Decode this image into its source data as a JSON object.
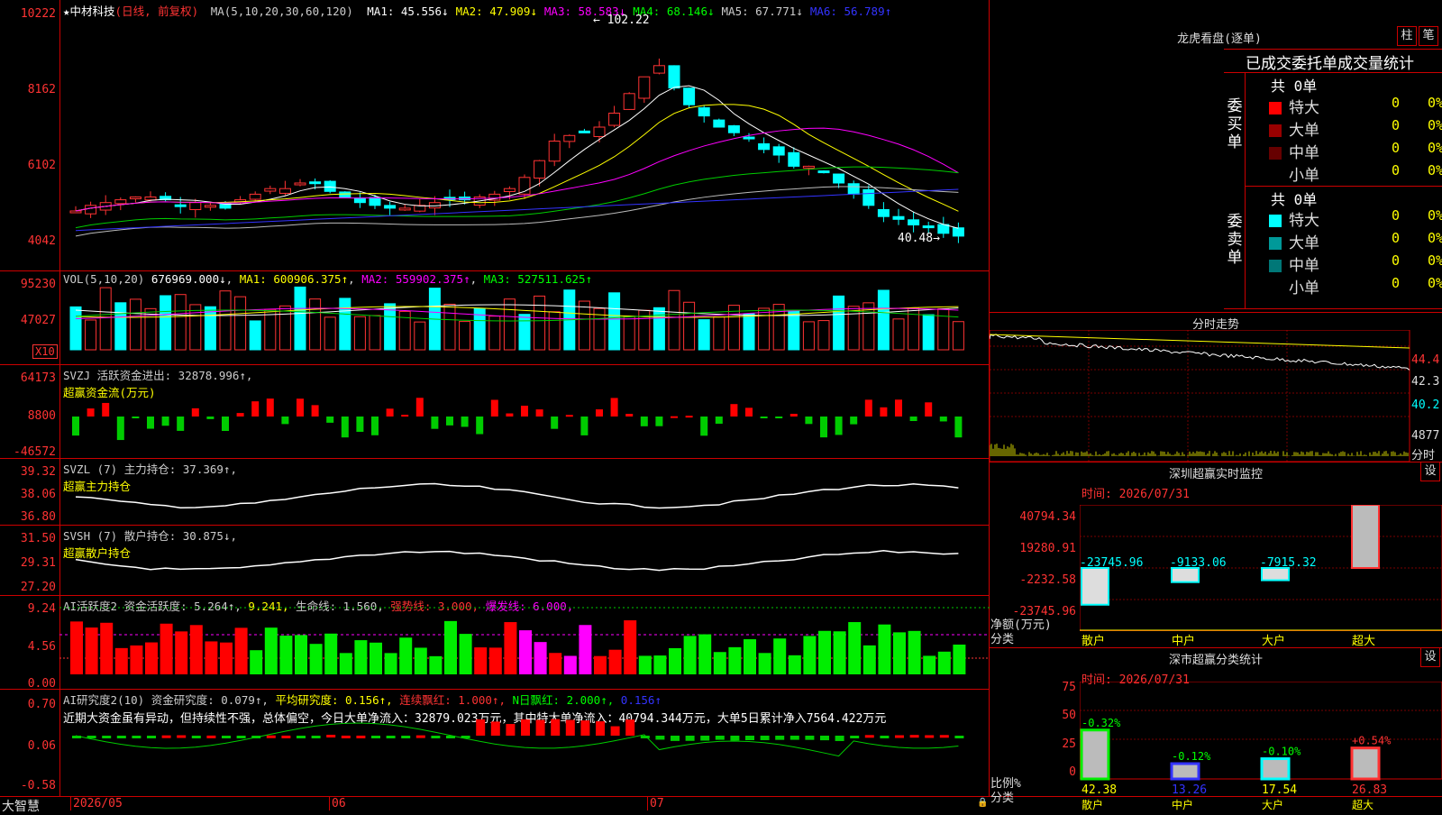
{
  "kline": {
    "star": "★",
    "name": "中材科技",
    "mode": "(日线, 前复权)",
    "ma_params": "MA(5,10,20,30,60,120)",
    "ma": [
      {
        "l": "MA1:",
        "v": "45.556↓",
        "c": "#fff"
      },
      {
        "l": "MA2:",
        "v": "47.909↓",
        "c": "#ff0"
      },
      {
        "l": "MA3:",
        "v": "58.583↓",
        "c": "#f0f"
      },
      {
        "l": "MA4:",
        "v": "68.146↓",
        "c": "#0f0"
      },
      {
        "l": "MA5:",
        "v": "67.771↓",
        "c": "#ccc"
      },
      {
        "l": "MA6:",
        "v": "56.789↑",
        "c": "#33f"
      }
    ],
    "axis": [
      "10222",
      "8162",
      "6102",
      "4042"
    ],
    "high_label": "102.22",
    "low_label": "40.48"
  },
  "vol": {
    "label": "VOL(5,10,20)",
    "v": "676969.000↓",
    "ma1": "MA1: 600906.375↑",
    "ma2": "MA2: 559902.375↑",
    "ma3": "MA3: 527511.625↑",
    "axis": [
      "95230",
      "47027"
    ],
    "unit": "X10"
  },
  "svzj": {
    "label": "SVZJ  活跃资金进出: 32878.996↑,",
    "sub": "超赢资金流(万元)",
    "axis": [
      "64173",
      "8800",
      "-46572"
    ]
  },
  "svzl": {
    "label": "SVZL (7) 主力持仓: 37.369↑,",
    "sub": "超赢主力持仓",
    "axis": [
      "39.32",
      "38.06",
      "36.80"
    ]
  },
  "svsh": {
    "label": "SVSH (7) 散户持仓: 30.875↓,",
    "sub": "超赢散户持仓",
    "axis": [
      "31.50",
      "29.31",
      "27.20"
    ]
  },
  "ai1": {
    "label": "AI活跃度2 资金活跃度: 5.264↑,",
    "v2": "9.241,",
    "life": "生命线: 1.560,",
    "strong": "强势线: 3.000,",
    "burst": "爆发线: 6.000,",
    "axis": [
      "9.24",
      "4.56",
      "0.00"
    ]
  },
  "ai2": {
    "label": "AI研究度2(10) 资金研究度: 0.079↑,",
    "avg": "平均研究度: 0.156↑,",
    "cont": "连续飘红: 1.000↑,",
    "nday": "N日飘红: 2.000↑,",
    "last": "0.156↑",
    "note": "近期大资金虽有异动，但持续性不强，总体偏空，今日大单净流入：32879.023万元，其中特大单净流入：40794.344万元，大单5日累计净入7564.422万元",
    "axis": [
      "0.70",
      "0.06",
      "-0.58"
    ]
  },
  "date_axis": {
    "brand": "大智慧",
    "d1": "2026/05",
    "d2": "06",
    "d3": "07"
  },
  "dragon": {
    "title": "龙虎看盘(逐单)",
    "btn1": "柱",
    "btn2": "笔",
    "subtitle": "已成交委托单成交量统计",
    "buy_side": "委买单",
    "sell_side": "委卖单",
    "buy_total": "共 0单",
    "sell_total": "共 0单",
    "buy_rows": [
      {
        "n": "特大",
        "v": "0",
        "p": "0%",
        "c": "#f00"
      },
      {
        "n": "大单",
        "v": "0",
        "p": "0%",
        "c": "#900"
      },
      {
        "n": "中单",
        "v": "0",
        "p": "0%",
        "c": "#600"
      },
      {
        "n": "小单",
        "v": "0",
        "p": "0%",
        "c": "#000"
      }
    ],
    "sell_rows": [
      {
        "n": "特大",
        "v": "0",
        "p": "0%",
        "c": "#0ff"
      },
      {
        "n": "大单",
        "v": "0",
        "p": "0%",
        "c": "#099"
      },
      {
        "n": "中单",
        "v": "0",
        "p": "0%",
        "c": "#077"
      },
      {
        "n": "小单",
        "v": "0",
        "p": "0%",
        "c": "#000"
      }
    ]
  },
  "intraday": {
    "title": "分时走势",
    "axis": [
      "44.4",
      "42.3",
      "40.2",
      "4877",
      "分时"
    ]
  },
  "monitor": {
    "title": "深圳超赢实时监控",
    "btn": "设",
    "time": "时间: 2026/07/31",
    "axis": [
      "40794.34",
      "19280.91",
      "-2232.58",
      "-23745.96"
    ],
    "ylabel": "净额(万元)",
    "xlabel": "分类",
    "cats": [
      "散户",
      "中户",
      "大户",
      "超大"
    ],
    "values": [
      "-23745.96",
      "-9133.06",
      "-7915.32",
      "40794.34"
    ]
  },
  "classify": {
    "title": "深市超赢分类统计",
    "btn": "设",
    "time": "时间: 2026/07/31",
    "axis": [
      "75",
      "50",
      "25",
      "0"
    ],
    "ylabel": "比例%",
    "xlabel": "分类",
    "cats": [
      "散户",
      "中户",
      "大户",
      "超大"
    ],
    "pct": [
      "-0.32%",
      "-0.12%",
      "-0.10%",
      "+0.54%"
    ],
    "vals": [
      "42.38",
      "13.26",
      "17.54",
      "26.83"
    ]
  }
}
